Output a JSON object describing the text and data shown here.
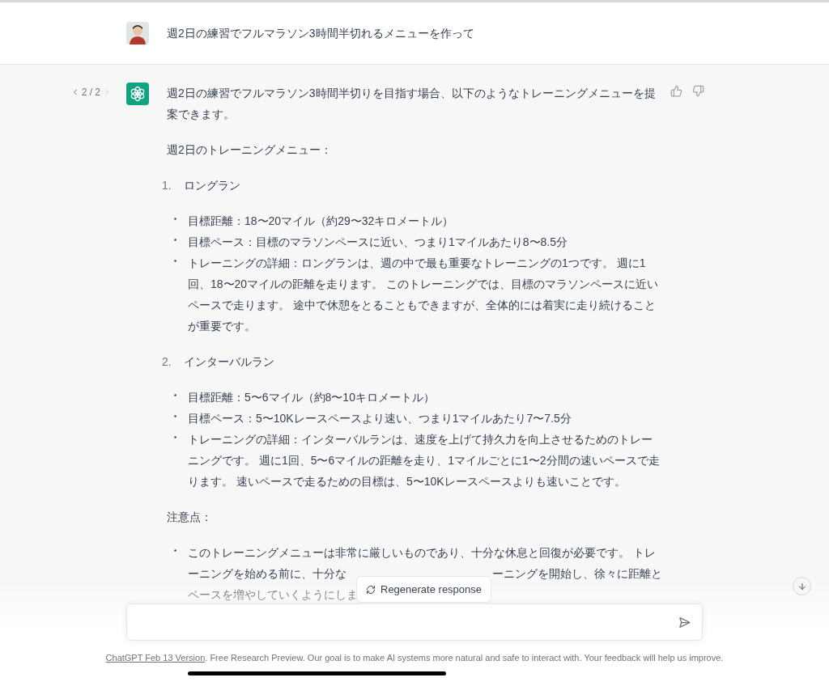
{
  "user_message": {
    "text": "週2日の練習でフルマラソン3時間半切れるメニューを作って"
  },
  "assistant_message": {
    "pager": "2 / 2",
    "intro": "週2日の練習でフルマラソン3時間半切りを目指す場合、以下のようなトレーニングメニューを提案できます。",
    "heading": "週2日のトレーニングメニュー：",
    "sections": [
      {
        "number": "1.",
        "title": "ロングラン",
        "bullets": [
          "目標距離：18〜20マイル（約29〜32キロメートル）",
          "目標ペース：目標のマラソンペースに近い、つまり1マイルあたり8〜8.5分",
          "トレーニングの詳細：ロングランは、週の中で最も重要なトレーニングの1つです。 週に1回、18〜20マイルの距離を走ります。 このトレーニングでは、目標のマラソンペースに近いペースで走ります。 途中で休憩をとることもできますが、全体的には着実に走り続けることが重要です。"
        ]
      },
      {
        "number": "2.",
        "title": "インターバルラン",
        "bullets": [
          "目標距離：5〜6マイル（約8〜10キロメートル）",
          "目標ペース：5〜10Kレースペースより速い、つまり1マイルあたり7〜7.5分",
          "トレーニングの詳細：インターバルランは、速度を上げて持久力を向上させるためのトレーニングです。 週に1回、5〜6マイルの距離を走り、1マイルごとに1〜2分間の速いペースで走ります。 速いペースで走るための目標は、5〜10Kレースペースよりも速いことです。"
        ]
      }
    ],
    "note_heading": "注意点：",
    "note_bullets": [
      {
        "lines": [
          {
            "parts": [
              "このトレーニングメニューは非常に厳しいものであり、十分な休息と回復が必要です。 トレ"
            ]
          },
          {
            "parts": [
              "ーニングを始める前に、十分な",
              "ーニングを開始し、徐々に距離と"
            ]
          },
          {
            "parts": [
              "ペースを増やしていくようにしま"
            ]
          }
        ]
      }
    ]
  },
  "regenerate_button": "Regenerate response",
  "footer": {
    "link": "ChatGPT Feb 13 Version",
    "text": ". Free Research Preview. Our goal is to make AI systems more natural and safe to interact with. Your feedback will help us improve."
  }
}
